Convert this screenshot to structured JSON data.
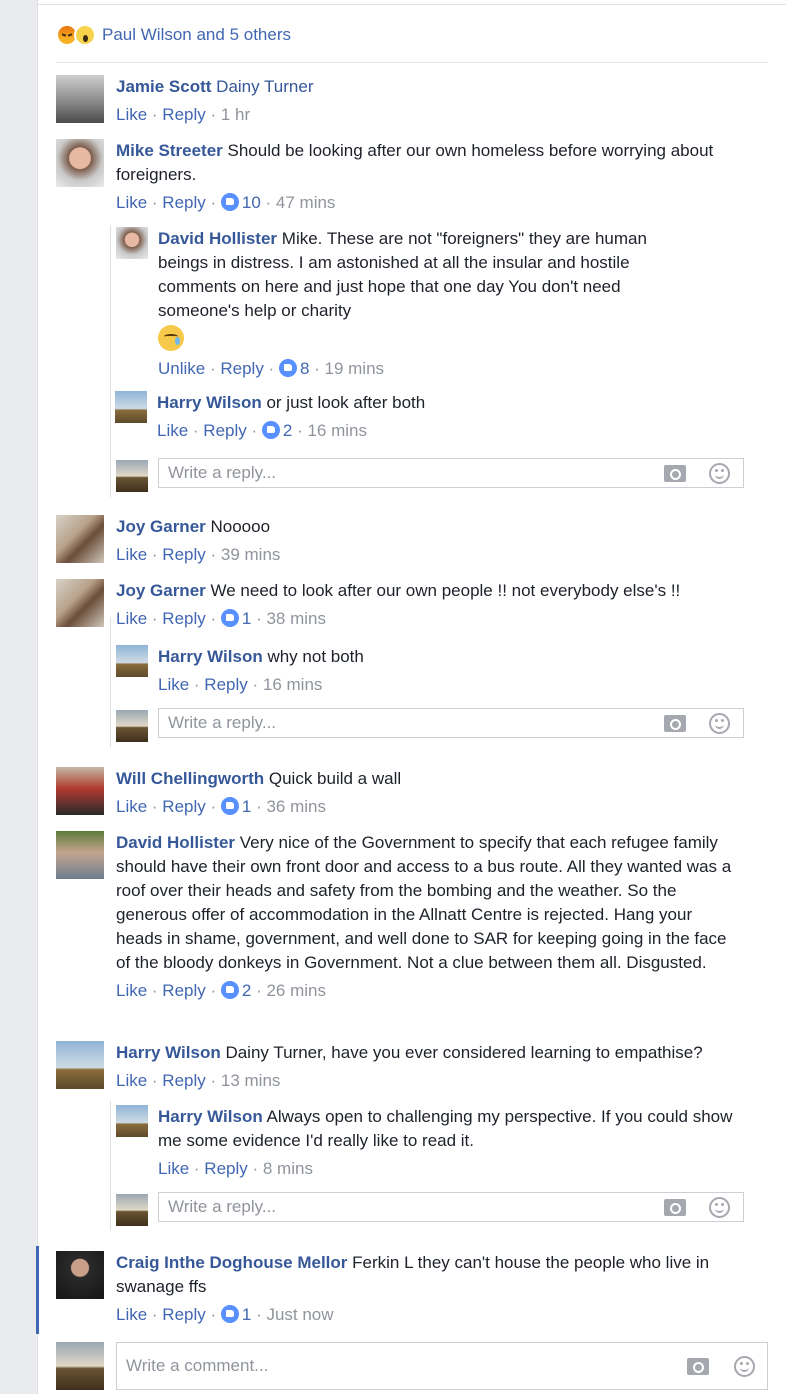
{
  "reactions": {
    "label": "Paul Wilson and 5 others"
  },
  "comments": [
    {
      "name": "Jamie Scott",
      "text": "Dainy Turner",
      "like": "Like",
      "reply": "Reply",
      "count": "",
      "time": "1 hr"
    },
    {
      "name": "Mike Streeter",
      "text": "Should be looking after our own homeless before worrying about foreigners.",
      "like": "Like",
      "reply": "Reply",
      "count": "10",
      "time": "47 mins",
      "replies": [
        {
          "name": "David Hollister",
          "text": "Mike. These are not \"foreigners\" they are human beings in distress. I am astonished at all the insular and hostile comments on here and just hope that one day You don't need someone's help or charity",
          "like": "Unlike",
          "reply": "Reply",
          "count": "8",
          "time": "19 mins"
        },
        {
          "name": "Harry Wilson",
          "text": "or just look after both",
          "like": "Like",
          "reply": "Reply",
          "count": "2",
          "time": "16 mins"
        }
      ]
    },
    {
      "name": "Joy Garner",
      "text": "Nooooo",
      "like": "Like",
      "reply": "Reply",
      "count": "",
      "time": "39 mins"
    },
    {
      "name": "Joy Garner",
      "text": "We need to look after our own people !! not everybody else's !!",
      "like": "Like",
      "reply": "Reply",
      "count": "1",
      "time": "38 mins",
      "replies": [
        {
          "name": "Harry Wilson",
          "text": "why not both",
          "like": "Like",
          "reply": "Reply",
          "count": "",
          "time": "16 mins"
        }
      ]
    },
    {
      "name": "Will Chellingworth",
      "text": "Quick build a wall",
      "like": "Like",
      "reply": "Reply",
      "count": "1",
      "time": "36 mins"
    },
    {
      "name": "David Hollister",
      "text": "Very nice of the Government to specify that each refugee family should have their own front door and access to a bus route. All they wanted was a roof over their heads and safety from the bombing and the weather. So the generous offer of accommodation in the Allnatt Centre is rejected. Hang your heads in shame, government, and well done to SAR for keeping going in the face of the bloody donkeys in Government. Not a clue between them all. Disgusted.",
      "like": "Like",
      "reply": "Reply",
      "count": "2",
      "time": "26 mins"
    },
    {
      "name": "Harry Wilson",
      "text": "Dainy Turner, have you ever considered learning to empathise?",
      "like": "Like",
      "reply": "Reply",
      "count": "",
      "time": "13 mins",
      "replies": [
        {
          "name": "Harry Wilson",
          "text": "Always open to challenging my perspective. If you could show me some evidence I'd really like to read it.",
          "like": "Like",
          "reply": "Reply",
          "count": "",
          "time": "8 mins"
        }
      ]
    },
    {
      "name": "Craig Inthe Doghouse Mellor",
      "text": "Ferkin L they can't house the people who live in swanage ffs",
      "like": "Like",
      "reply": "Reply",
      "count": "1",
      "time": "Just now"
    }
  ],
  "reply_placeholder": "Write a reply...",
  "comment_placeholder": "Write a comment...",
  "colors": {
    "link": "#365899",
    "action": "#4267b2",
    "meta": "#90949c",
    "like_badge": "#5890ff"
  }
}
